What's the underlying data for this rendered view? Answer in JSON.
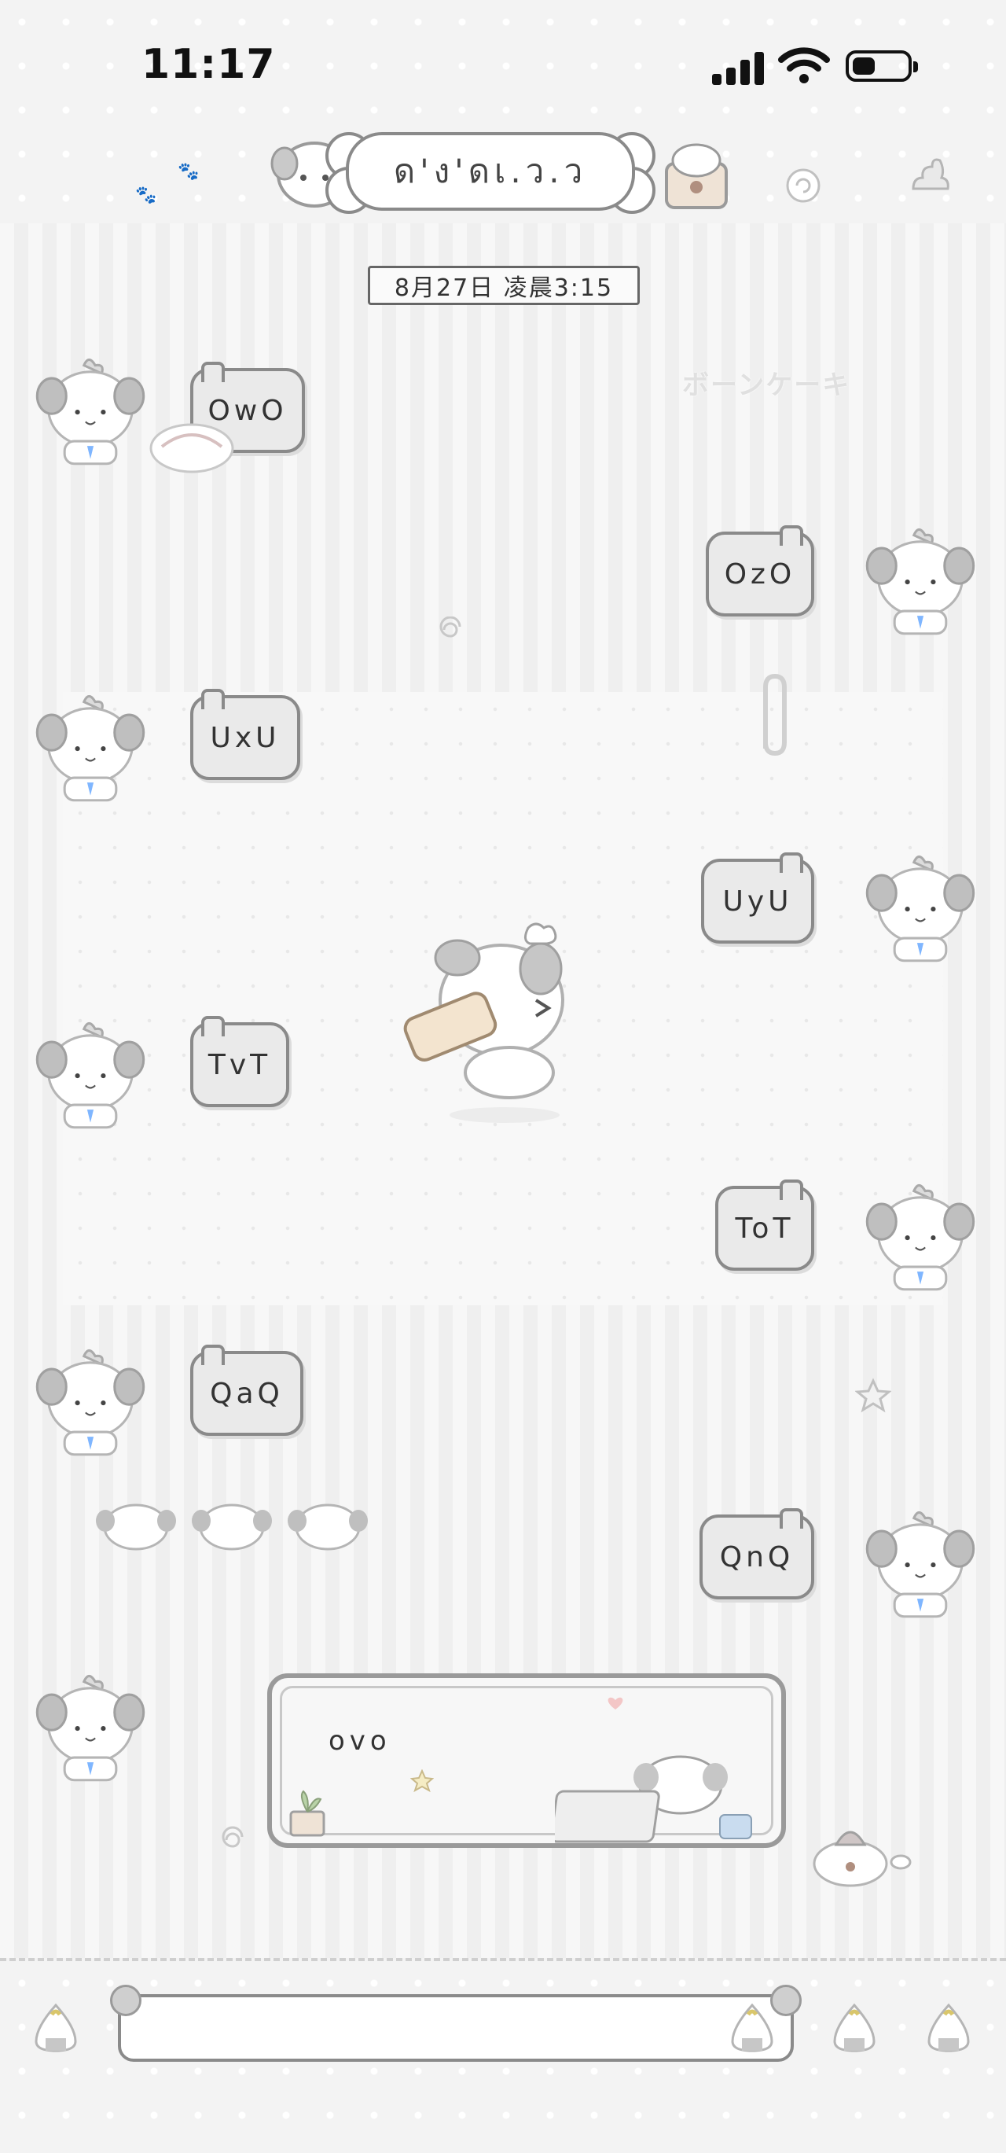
{
  "status_bar": {
    "time": "11:17"
  },
  "header": {
    "title": "ด'ง'ดเ.ว.ว"
  },
  "chat": {
    "date_label": "8月27日 凌晨3:15",
    "watermark": "ボーンケーキ",
    "messages": [
      {
        "side": "left",
        "text": "OwO"
      },
      {
        "side": "right",
        "text": "OzO"
      },
      {
        "side": "left",
        "text": "UxU"
      },
      {
        "side": "right",
        "text": "UyU"
      },
      {
        "side": "left",
        "text": "TvT"
      },
      {
        "side": "right",
        "text": "ToT"
      },
      {
        "side": "left",
        "text": "QaQ"
      },
      {
        "side": "right",
        "text": "QnQ"
      }
    ],
    "card_message": {
      "side": "left",
      "text": "ovo"
    }
  },
  "input": {
    "placeholder": ""
  },
  "colors": {
    "background": "#f4f4f4",
    "bubble": "#eaeaea",
    "border": "#8a8a8a",
    "text": "#333333"
  }
}
